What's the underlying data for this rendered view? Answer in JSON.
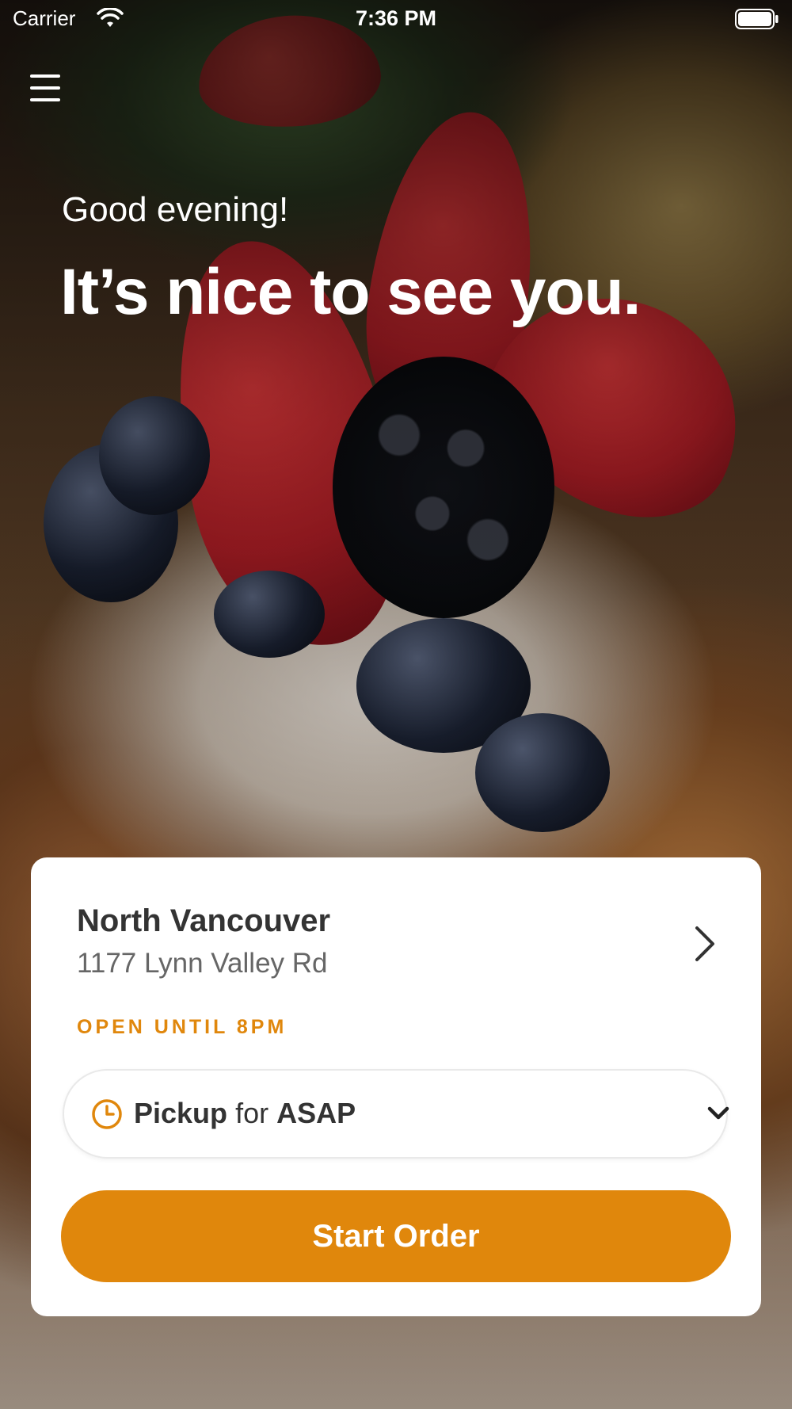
{
  "status_bar": {
    "carrier": "Carrier",
    "time": "7:36 PM",
    "wifi_icon": "wifi-icon",
    "battery_icon": "battery-icon"
  },
  "header": {
    "menu_icon": "hamburger-menu-icon",
    "greeting": "Good evening!",
    "headline": "It’s nice to see you."
  },
  "location": {
    "name": "North Vancouver",
    "address": "1177 Lynn Valley Rd",
    "open_status": "OPEN UNTIL 8PM",
    "chevron_icon": "chevron-right-icon"
  },
  "order_time": {
    "icon": "clock-icon",
    "mode": "Pickup",
    "connector": "for",
    "time": "ASAP",
    "chevron_icon": "chevron-down-icon"
  },
  "actions": {
    "start_order_label": "Start Order"
  },
  "colors": {
    "accent": "#e0870c",
    "card_bg": "#ffffff",
    "text_dark": "#333333",
    "text_muted": "#666666"
  }
}
